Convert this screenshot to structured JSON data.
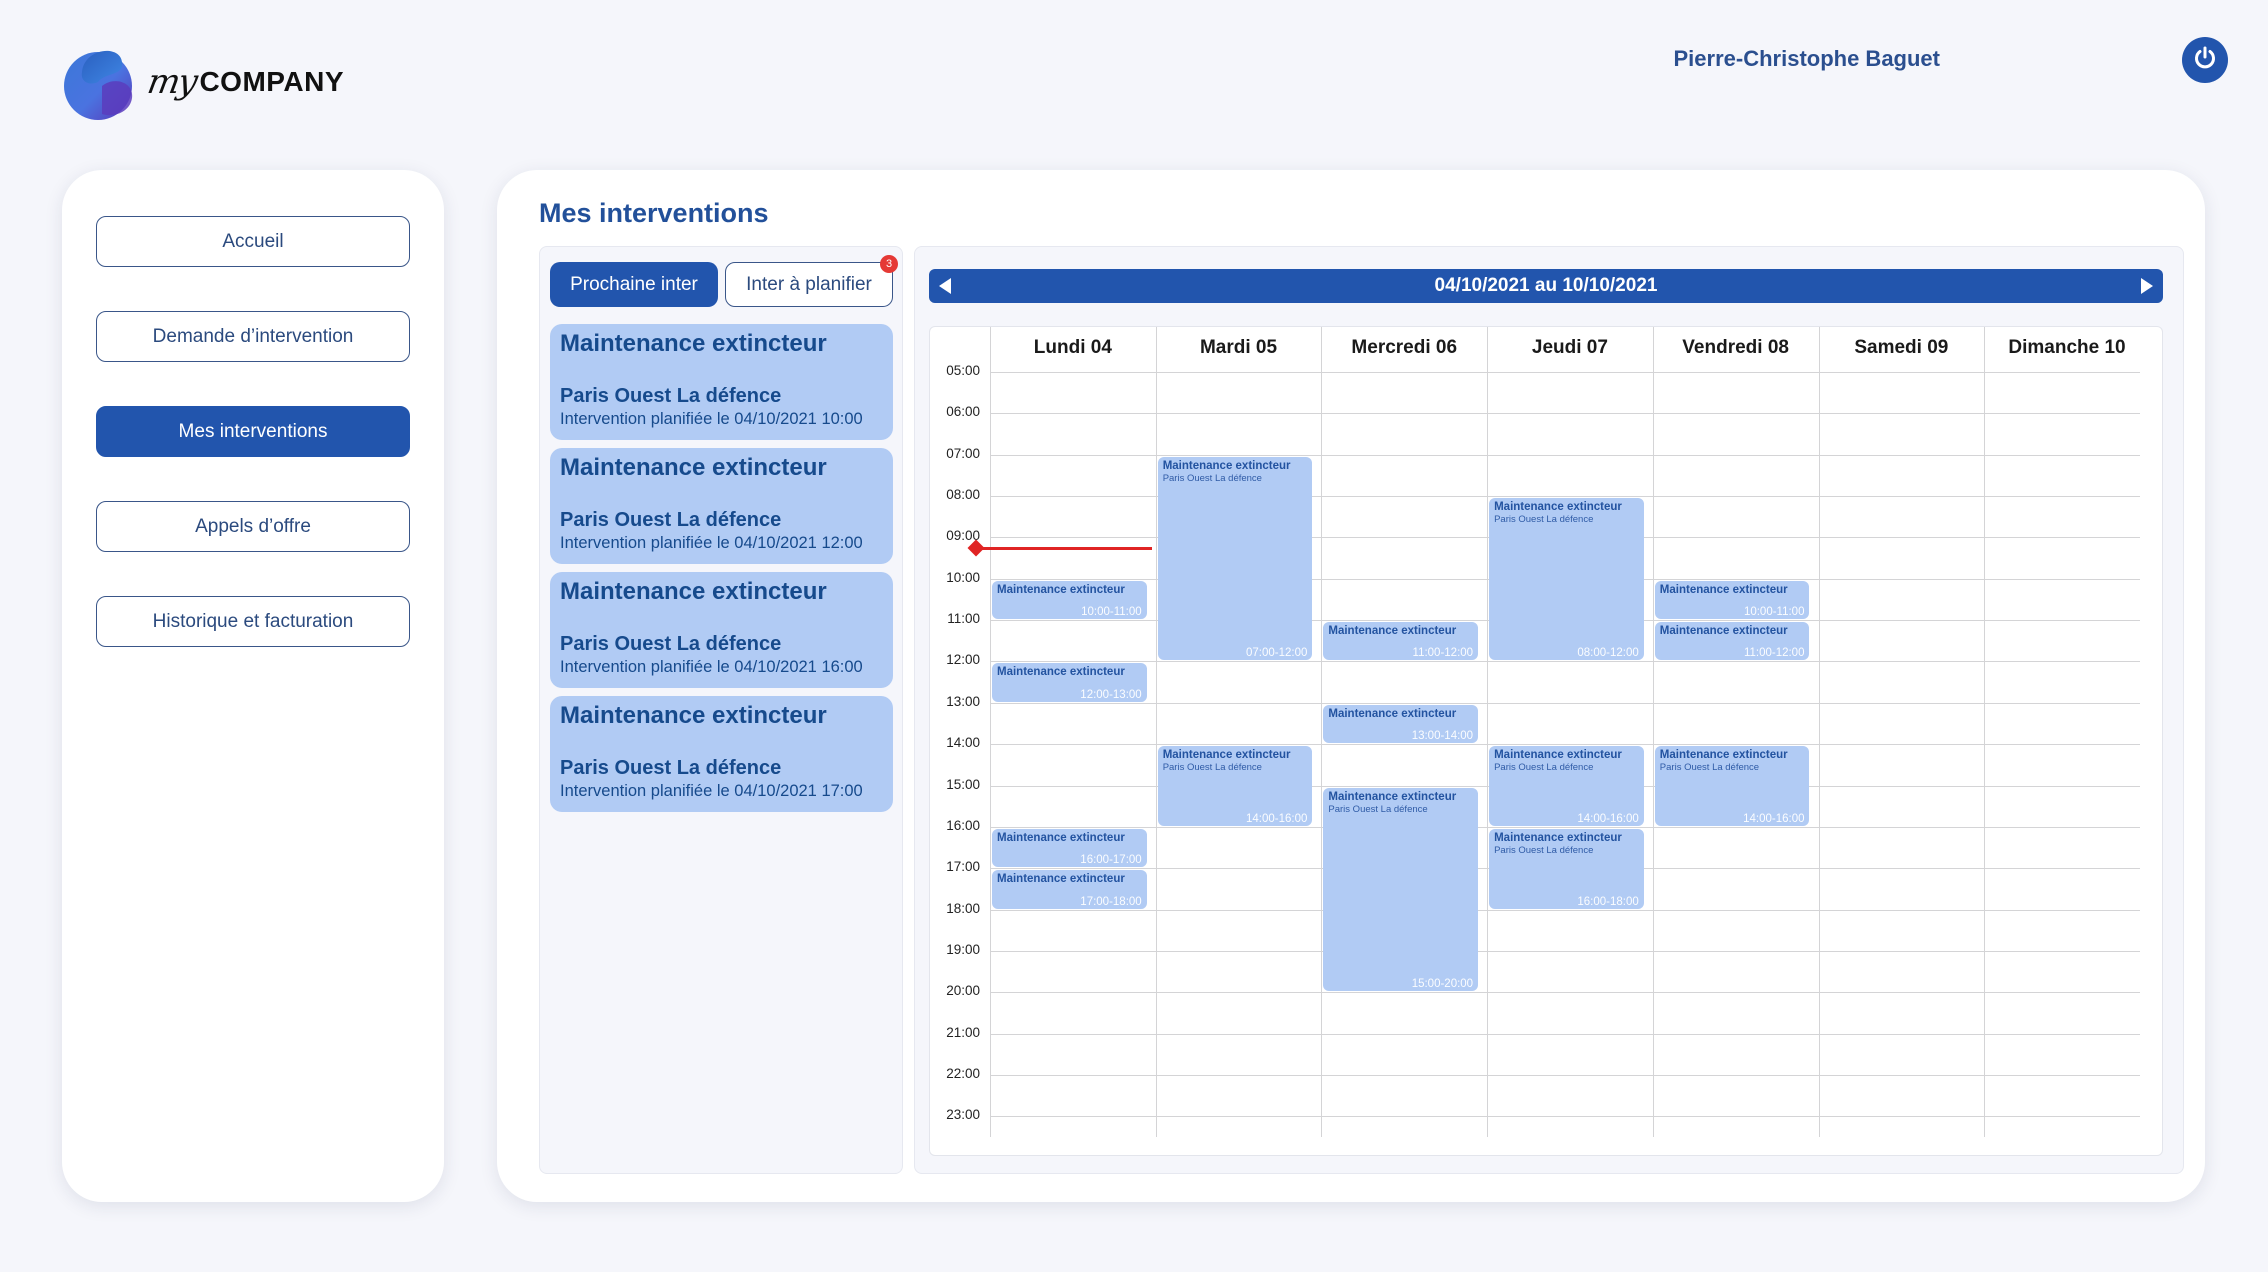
{
  "brand": {
    "prefix": "my",
    "name": "COMPANY"
  },
  "header": {
    "user_name": "Pierre-Christophe Baguet",
    "logout_icon": "power-icon"
  },
  "sidebar": {
    "items": [
      {
        "label": "Accueil",
        "active": false
      },
      {
        "label": "Demande d’intervention",
        "active": false
      },
      {
        "label": "Mes interventions",
        "active": true
      },
      {
        "label": "Appels d’offre",
        "active": false
      },
      {
        "label": "Historique et facturation",
        "active": false
      }
    ]
  },
  "main": {
    "title": "Mes interventions",
    "tabs": [
      {
        "label": "Prochaine inter",
        "active": true
      },
      {
        "label": "Inter à planifier",
        "active": false,
        "badge": "3"
      }
    ],
    "upcoming": [
      {
        "title": "Maintenance extincteur",
        "location": "Paris Ouest La défence",
        "date": "Intervention planifiée le 04/10/2021 10:00"
      },
      {
        "title": "Maintenance extincteur",
        "location": "Paris Ouest La défence",
        "date": "Intervention planifiée le 04/10/2021 12:00"
      },
      {
        "title": "Maintenance extincteur",
        "location": "Paris Ouest La défence",
        "date": "Intervention planifiée le 04/10/2021 16:00"
      },
      {
        "title": "Maintenance extincteur",
        "location": "Paris Ouest La défence",
        "date": "Intervention planifiée le 04/10/2021 17:00"
      }
    ]
  },
  "calendar": {
    "range": "04/10/2021 au 10/10/2021",
    "prev_icon": "caret-left-icon",
    "next_icon": "caret-right-icon",
    "days": [
      "Lundi 04",
      "Mardi 05",
      "Mercredi 06",
      "Jeudi 07",
      "Vendredi 08",
      "Samedi 09",
      "Dimanche 10"
    ],
    "hours": [
      "05:00",
      "06:00",
      "07:00",
      "08:00",
      "09:00",
      "10:00",
      "11:00",
      "12:00",
      "13:00",
      "14:00",
      "15:00",
      "16:00",
      "17:00",
      "18:00",
      "19:00",
      "20:00",
      "21:00",
      "22:00",
      "23:00"
    ],
    "now": {
      "day": 0,
      "time": 9.25
    },
    "events": [
      {
        "day": 0,
        "start": 10,
        "end": 11,
        "title": "Maintenance extincteur",
        "location": "",
        "time": "10:00-11:00"
      },
      {
        "day": 0,
        "start": 12,
        "end": 13,
        "title": "Maintenance extincteur",
        "location": "",
        "time": "12:00-13:00"
      },
      {
        "day": 0,
        "start": 16,
        "end": 17,
        "title": "Maintenance extincteur",
        "location": "",
        "time": "16:00-17:00"
      },
      {
        "day": 0,
        "start": 17,
        "end": 18,
        "title": "Maintenance extincteur",
        "location": "",
        "time": "17:00-18:00"
      },
      {
        "day": 1,
        "start": 7,
        "end": 12,
        "title": "Maintenance extincteur",
        "location": "Paris Ouest La défence",
        "time": "07:00-12:00"
      },
      {
        "day": 1,
        "start": 14,
        "end": 16,
        "title": "Maintenance extincteur",
        "location": "Paris Ouest La défence",
        "time": "14:00-16:00"
      },
      {
        "day": 2,
        "start": 11,
        "end": 12,
        "title": "Maintenance extincteur",
        "location": "",
        "time": "11:00-12:00"
      },
      {
        "day": 2,
        "start": 13,
        "end": 14,
        "title": "Maintenance extincteur",
        "location": "",
        "time": "13:00-14:00"
      },
      {
        "day": 2,
        "start": 15,
        "end": 20,
        "title": "Maintenance extincteur",
        "location": "Paris Ouest La défence",
        "time": "15:00-20:00"
      },
      {
        "day": 3,
        "start": 8,
        "end": 12,
        "title": "Maintenance extincteur",
        "location": "Paris Ouest La défence",
        "time": "08:00-12:00"
      },
      {
        "day": 3,
        "start": 14,
        "end": 16,
        "title": "Maintenance extincteur",
        "location": "Paris Ouest La défence",
        "time": "14:00-16:00"
      },
      {
        "day": 3,
        "start": 16,
        "end": 18,
        "title": "Maintenance extincteur",
        "location": "Paris Ouest La défence",
        "time": "16:00-18:00"
      },
      {
        "day": 4,
        "start": 10,
        "end": 11,
        "title": "Maintenance extincteur",
        "location": "",
        "time": "10:00-11:00"
      },
      {
        "day": 4,
        "start": 11,
        "end": 12,
        "title": "Maintenance extincteur",
        "location": "",
        "time": "11:00-12:00"
      },
      {
        "day": 4,
        "start": 14,
        "end": 16,
        "title": "Maintenance extincteur",
        "location": "Paris Ouest La défence",
        "time": "14:00-16:00"
      }
    ]
  },
  "colors": {
    "primary": "#2255ad",
    "event_bg": "#b1cbf4",
    "event_text": "#2353a0",
    "now_line": "#e02424",
    "badge": "#e53935"
  }
}
